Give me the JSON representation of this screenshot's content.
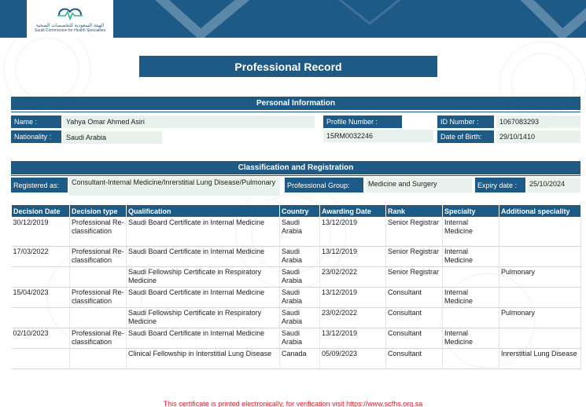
{
  "header": {
    "logo_ar": "الهيئة السعودية للتخصصات الصحية",
    "logo_en": "Saudi Commission for Health Specialties"
  },
  "title": "Professional Record",
  "personal": {
    "section_title": "Personal Information",
    "name_label": "Name :",
    "name_value": "Yahya Omar Ahmed Asiri",
    "profile_label": "Profile Number :",
    "profile_value": "15RM0032246",
    "id_label": "ID Number :",
    "id_value": "1067083293",
    "nationality_label": "Nationality :",
    "nationality_value": "Saudi Arabia",
    "dob_label": "Date of Birth:",
    "dob_value": "29/10/1410"
  },
  "classification": {
    "section_title": "Classification and Registration",
    "registered_label": "Registered as:",
    "registered_value": "Consultant-Internal Medicine/Inrerstitial Lung Disease/Pulmonary",
    "group_label": "Professional Group:",
    "group_value": "Medicine and Surgery",
    "expiry_label": "Expiry date :",
    "expiry_value": "25/10/2024"
  },
  "table": {
    "headers": [
      "Decision Date",
      "Decision type",
      "Qualification",
      "Country",
      "Awarding Date",
      "Rank",
      "Specialty",
      "Additional speciality"
    ],
    "rows": [
      [
        "30/12/2019",
        "Professional Re-classification",
        "Saudi Board Certificate in Internal Medicine",
        "Saudi Arabia",
        "13/12/2019",
        "Senior Registrar",
        "Internal Medicine",
        ""
      ],
      [
        "17/03/2022",
        "Professional Re-classification",
        "Saudi Board Certificate in Internal Medicine",
        "Saudi Arabia",
        "13/12/2019",
        "Senior Registrar",
        "Internal Medicine",
        ""
      ],
      [
        "",
        "",
        "Saudi Fellowship Certificate in Respiratory Medicine",
        "Saudi Arabia",
        "23/02/2022",
        "Senior Registrar",
        "",
        "Pulmonary"
      ],
      [
        "15/04/2023",
        "Professional Re-classification",
        "Saudi Board Certificate in Internal Medicine",
        "Saudi Arabia",
        "13/12/2019",
        "Consultant",
        "Internal Medicine",
        ""
      ],
      [
        "",
        "",
        "Saudi Fellowship Certificate in Respiratory Medicine",
        "Saudi Arabia",
        "23/02/2022",
        "Consultant",
        "",
        "Pulmonary"
      ],
      [
        "02/10/2023",
        "Professional Re-classification",
        "Saudi Board Certificate in Internal Medicine",
        "Saudi Arabia",
        "13/12/2019",
        "Consultant",
        "Internal Medicine",
        ""
      ],
      [
        "",
        "",
        "Clinical Fellowship in Interstitial Lung Disease",
        "Canada",
        "05/09/2023",
        "Consultant",
        "",
        "Inrerstitial Lung Disease"
      ]
    ]
  },
  "footer": "This certificate is printed electronically, for verification visit https://www.scfhs.org.sa"
}
